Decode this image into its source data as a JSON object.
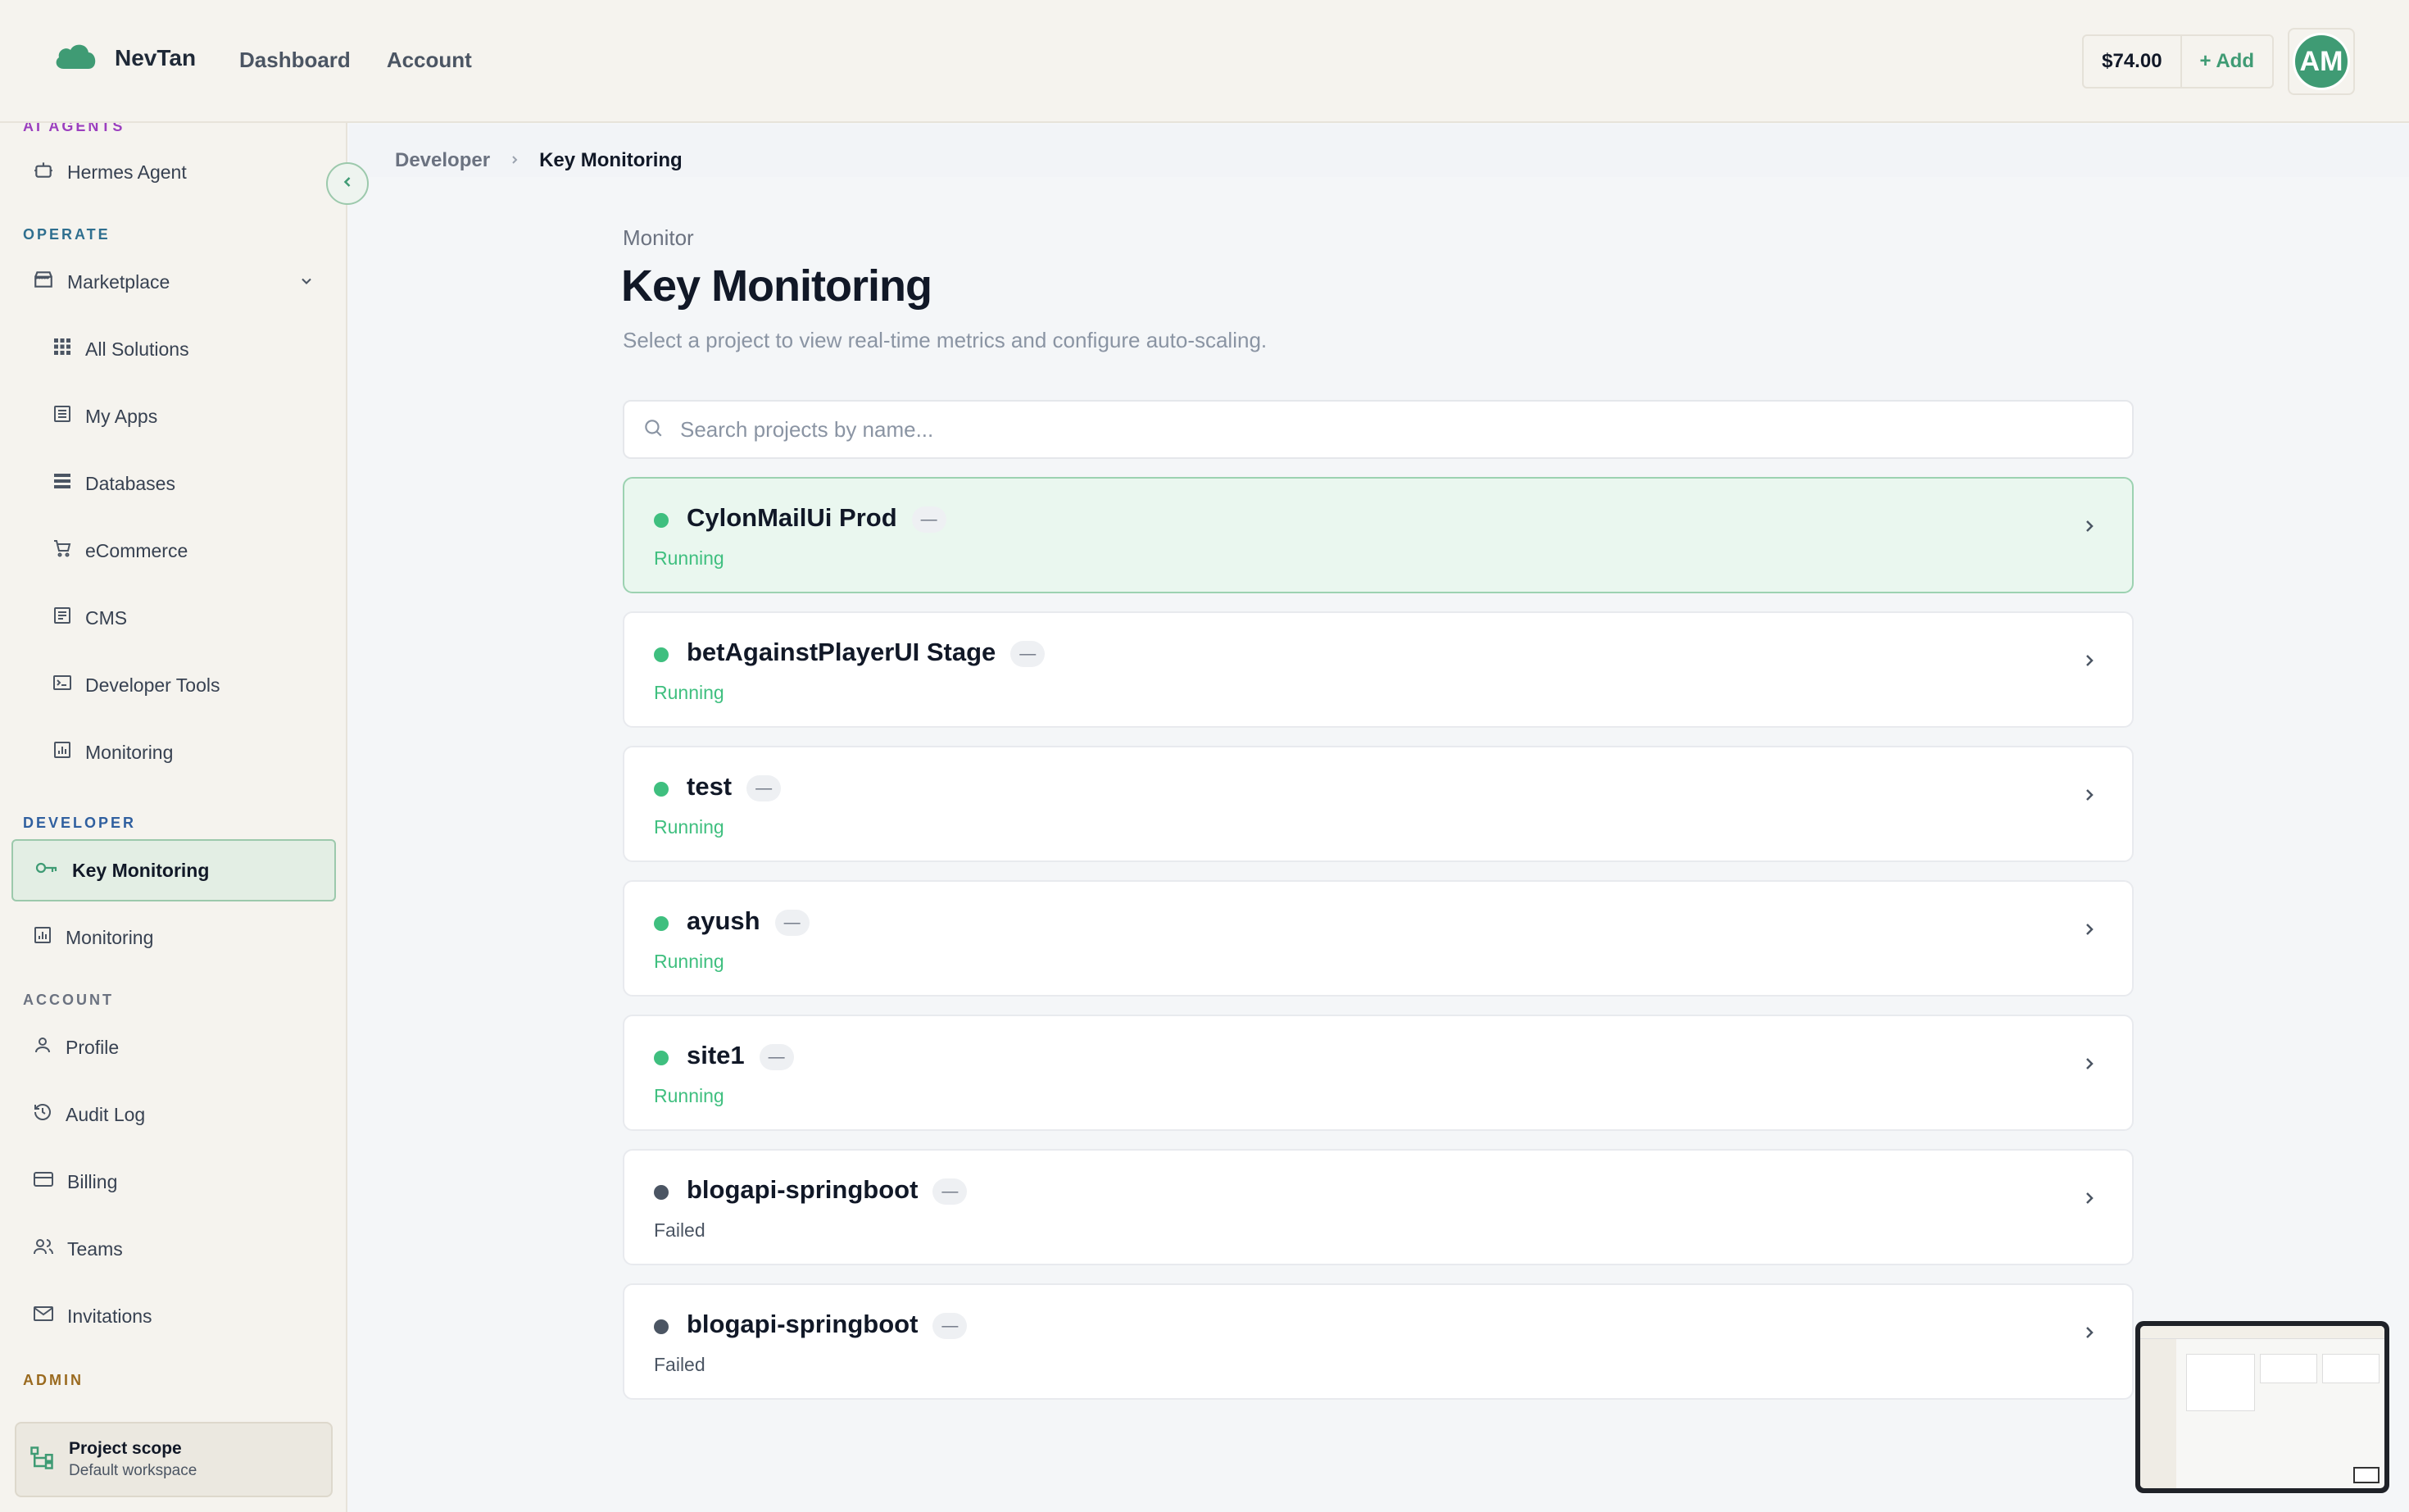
{
  "app": {
    "name": "NevTan"
  },
  "nav": {
    "items": [
      "Dashboard",
      "Account"
    ]
  },
  "wallet": {
    "balance": "$74.00",
    "add_label": "+ Add"
  },
  "user": {
    "initials": "AM"
  },
  "sidebar": {
    "sections": {
      "ai_agents": "AI AGENTS",
      "operate": "OPERATE",
      "developer": "DEVELOPER",
      "account": "ACCOUNT",
      "admin": "ADMIN"
    },
    "items": {
      "hermes": "Hermes Agent",
      "marketplace": "Marketplace",
      "all_solutions": "All Solutions",
      "my_apps": "My Apps",
      "databases": "Databases",
      "ecommerce": "eCommerce",
      "cms": "CMS",
      "developer_tools": "Developer Tools",
      "monitoring_operate": "Monitoring",
      "key_monitoring": "Key Monitoring",
      "monitoring_dev": "Monitoring",
      "profile": "Profile",
      "audit_log": "Audit Log",
      "billing": "Billing",
      "teams": "Teams",
      "invitations": "Invitations"
    },
    "scope": {
      "title": "Project scope",
      "subtitle": "Default workspace"
    }
  },
  "breadcrumb": {
    "parent": "Developer",
    "current": "Key Monitoring"
  },
  "page": {
    "eyebrow": "Monitor",
    "title": "Key Monitoring",
    "subtitle": "Select a project to view real-time metrics and configure auto-scaling."
  },
  "search": {
    "placeholder": "Search projects by name..."
  },
  "projects": [
    {
      "name": "CylonMailUi Prod",
      "badge": "—",
      "status": "Running"
    },
    {
      "name": "betAgainstPlayerUI Stage",
      "badge": "—",
      "status": "Running"
    },
    {
      "name": "test",
      "badge": "—",
      "status": "Running"
    },
    {
      "name": "ayush",
      "badge": "—",
      "status": "Running"
    },
    {
      "name": "site1",
      "badge": "—",
      "status": "Running"
    },
    {
      "name": "blogapi-springboot",
      "badge": "—",
      "status": "Failed"
    },
    {
      "name": "blogapi-springboot",
      "badge": "—",
      "status": "Failed"
    }
  ],
  "colors": {
    "accent": "#3f9b74",
    "running": "#3fbf7f",
    "failed": "#4b5563",
    "section_ai": "#9b3fbf",
    "section_operate": "#2f6f8f",
    "section_developer": "#2f5f9f",
    "section_account": "#6b7280",
    "section_admin": "#9a6a1f"
  }
}
